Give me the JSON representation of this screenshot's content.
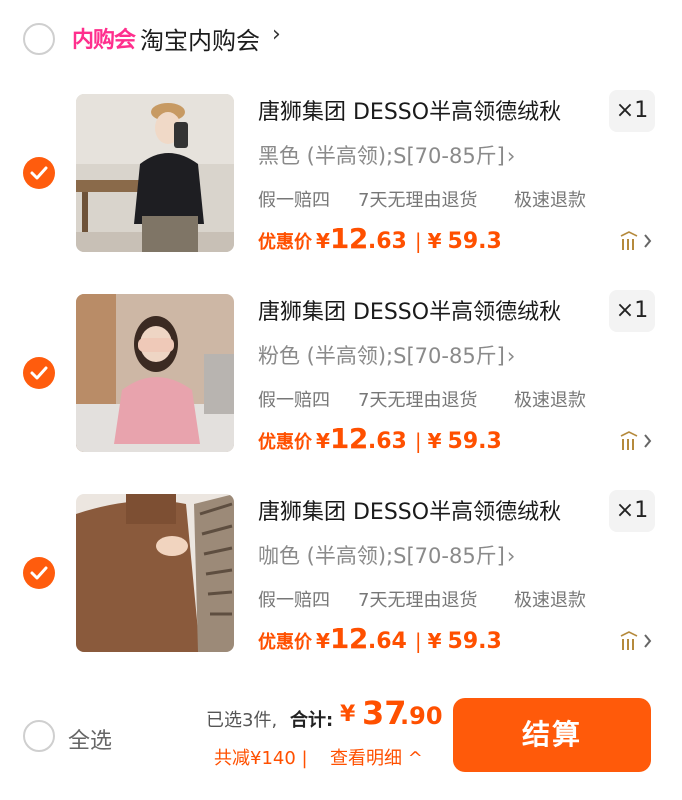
{
  "store": {
    "badge": "内购会",
    "name": "淘宝内购会",
    "chevron": "›"
  },
  "items": [
    {
      "title": "唐狮集团 DESSO半高领德绒秋",
      "qty": "×1",
      "sku": "黑色 (半高领);S[70-85斤]",
      "services": [
        "假一赔四",
        "7天无理由退货",
        "极速退款"
      ],
      "price_label": "优惠价",
      "price_yen": "¥",
      "price_int": "12",
      "price_dec": ".63",
      "sep": "|",
      "orig_yen": "¥",
      "orig_price": "59.3",
      "checked": true
    },
    {
      "title": "唐狮集团 DESSO半高领德绒秋",
      "qty": "×1",
      "sku": "粉色 (半高领);S[70-85斤]",
      "services": [
        "假一赔四",
        "7天无理由退货",
        "极速退款"
      ],
      "price_label": "优惠价",
      "price_yen": "¥",
      "price_int": "12",
      "price_dec": ".63",
      "sep": "|",
      "orig_yen": "¥",
      "orig_price": "59.3",
      "checked": true
    },
    {
      "title": "唐狮集团 DESSO半高领德绒秋",
      "qty": "×1",
      "sku": "咖色 (半高领);S[70-85斤]",
      "services": [
        "假一赔四",
        "7天无理由退货",
        "极速退款"
      ],
      "price_label": "优惠价",
      "price_yen": "¥",
      "price_int": "12",
      "price_dec": ".64",
      "sep": "|",
      "orig_yen": "¥",
      "orig_price": "59.3",
      "checked": true
    }
  ],
  "bottom": {
    "select_all": "全选",
    "selected_count": "已选3件,",
    "total_label": "合计:",
    "total_yen": "¥",
    "total_int": "37",
    "total_dec": ".90",
    "discount": "共减¥140 |",
    "detail": "查看明细 ^",
    "checkout": "结算"
  },
  "colors": {
    "accent": "#ff5000",
    "checkout_bg": "#ff5a0a",
    "badge": "#ff2f8d"
  },
  "icons": {
    "check": "check-icon",
    "similar": "similar-items-icon"
  }
}
